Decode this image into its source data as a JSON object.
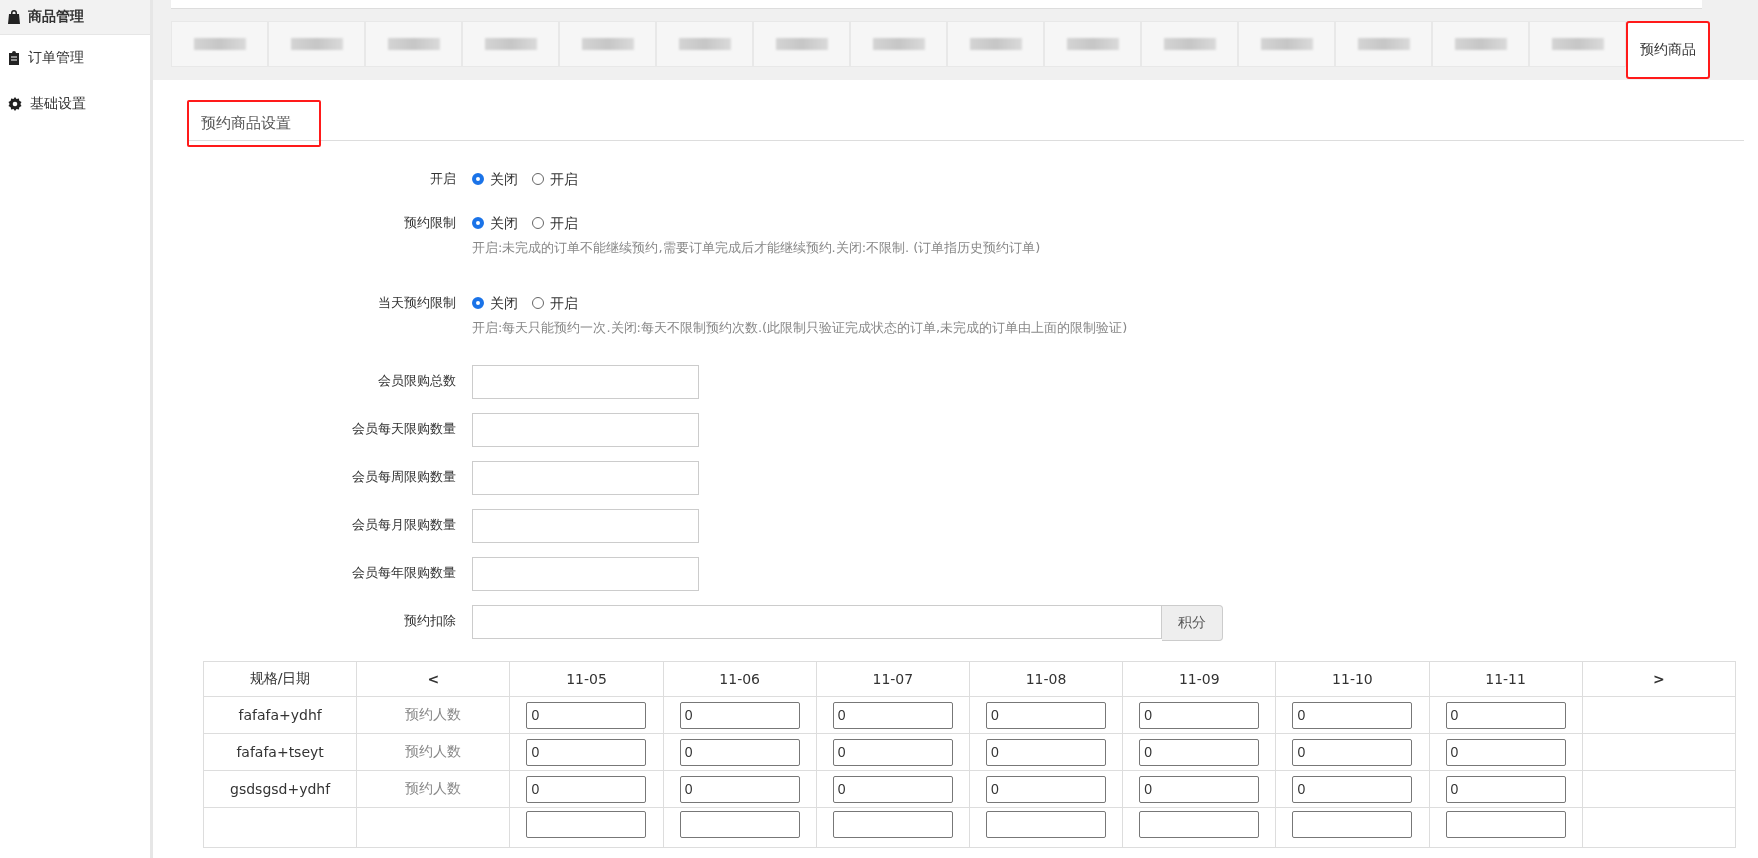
{
  "sidebar": {
    "items": [
      {
        "label": "商品管理",
        "kind": "bag",
        "selected": true
      },
      {
        "label": "订单管理",
        "kind": "clipboard",
        "selected": false
      },
      {
        "label": "基础设置",
        "kind": "gear",
        "selected": false
      }
    ]
  },
  "tabs": [
    {
      "kind": "blurred"
    },
    {
      "kind": "blurred"
    },
    {
      "kind": "blurred"
    },
    {
      "kind": "blurred"
    },
    {
      "kind": "blurred"
    },
    {
      "kind": "blurred"
    },
    {
      "kind": "blurred"
    },
    {
      "kind": "blurred"
    },
    {
      "kind": "blurred"
    },
    {
      "kind": "blurred"
    },
    {
      "kind": "blurred"
    },
    {
      "kind": "blurred"
    },
    {
      "kind": "blurred"
    },
    {
      "kind": "blurred"
    },
    {
      "kind": "blurred"
    },
    {
      "kind": "tab",
      "label": "预约商品",
      "selected": true,
      "highlighted": true
    }
  ],
  "panel": {
    "title": "预约商品设置",
    "highlighted": true
  },
  "switches": [
    {
      "label": "开启",
      "options": [
        {
          "label": "关闭",
          "selected": true
        },
        {
          "label": "开启",
          "selected": false
        }
      ]
    },
    {
      "label": "预约限制",
      "options": [
        {
          "label": "关闭",
          "selected": true
        },
        {
          "label": "开启",
          "selected": false
        }
      ],
      "help": "开启:未完成的订单不能继续预约,需要订单完成后才能继续预约.关闭:不限制. (订单指历史预约订单)"
    },
    {
      "label": "当天预约限制",
      "options": [
        {
          "label": "关闭",
          "selected": true
        },
        {
          "label": "开启",
          "selected": false
        }
      ],
      "help": "开启:每天只能预约一次.关闭:每天不限制预约次数.(此限制只验证完成状态的订单,未完成的订单由上面的限制验证)"
    }
  ],
  "limits": [
    {
      "label": "会员限购总数"
    },
    {
      "label": "会员每天限购数量"
    },
    {
      "label": "会员每周限购数量"
    },
    {
      "label": "会员每月限购数量"
    },
    {
      "label": "会员每年限购数量"
    }
  ],
  "deduct": {
    "label": "预约扣除",
    "addon": "积分"
  },
  "table": {
    "columns": [
      "规格/日期",
      "<",
      "11-05",
      "11-06",
      "11-07",
      "11-08",
      "11-09",
      "11-10",
      "11-11",
      ">"
    ],
    "rows": [
      {
        "spec": "fafafa+ydhf",
        "type": "预约人数",
        "values": [
          "0",
          "0",
          "0",
          "0",
          "0",
          "0",
          "0"
        ]
      },
      {
        "spec": "fafafa+tseyt",
        "type": "预约人数",
        "values": [
          "0",
          "0",
          "0",
          "0",
          "0",
          "0",
          "0"
        ]
      },
      {
        "spec": "gsdsgsd+ydhf",
        "type": "预约人数",
        "values": [
          "0",
          "0",
          "0",
          "0",
          "0",
          "0",
          "0"
        ]
      }
    ]
  }
}
